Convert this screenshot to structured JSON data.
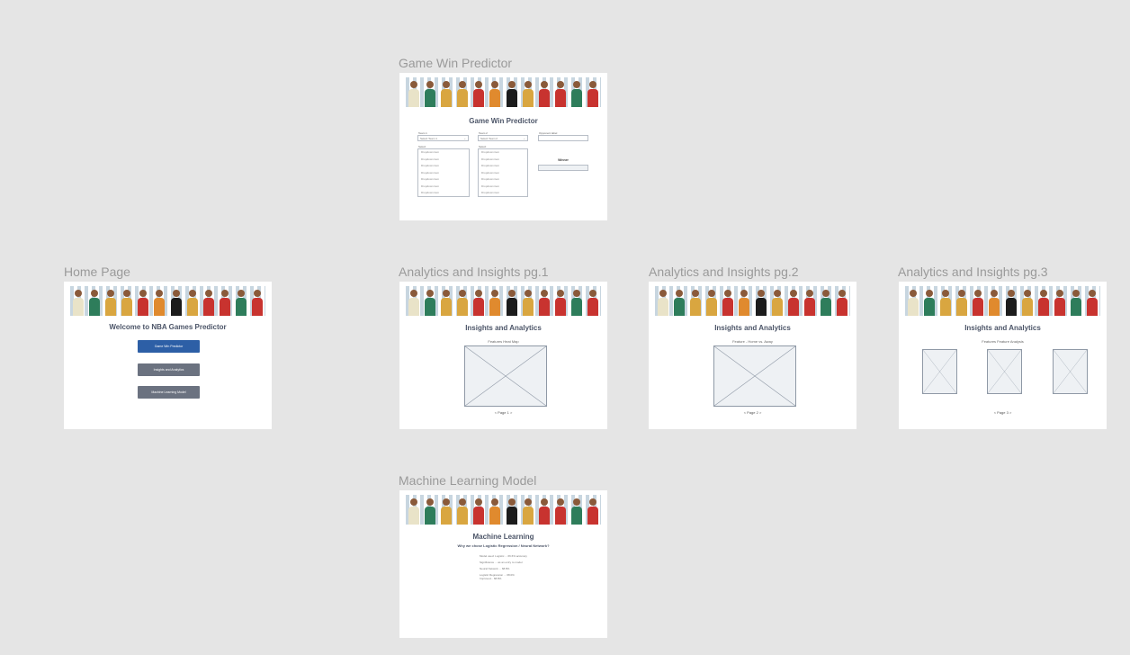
{
  "frames": {
    "gwp": {
      "label": "Game Win Predictor"
    },
    "home": {
      "label": "Home Page"
    },
    "a1": {
      "label": "Analytics and Insights pg.1"
    },
    "a2": {
      "label": "Analytics and Insights pg.2"
    },
    "a3": {
      "label": "Analytics and Insights pg.3"
    },
    "ml": {
      "label": "Machine Learning Model"
    }
  },
  "home": {
    "title": "Welcome to NBA Games Predictor",
    "buttons": [
      "Game Win Predictor",
      "Insights and Analytics",
      "Machine Learning Model"
    ]
  },
  "gwp": {
    "title": "Game Win Predictor",
    "team1_label": "Team 1",
    "team1_value": "Select Team 1",
    "team2_label": "Team 2",
    "team2_value": "Select Team 2",
    "extra_label": "Opponent label",
    "list1_label": "Select",
    "list2_label": "Select",
    "list_items": [
      "Dropdown item",
      "Dropdown item",
      "Dropdown item",
      "Dropdown item",
      "Dropdown item",
      "Dropdown item",
      "Dropdown item"
    ],
    "winner_label": "Winner"
  },
  "analytics": {
    "title": "Insights and Analytics",
    "p1_caption": "Features Heat Map",
    "p1_page": "Page 1",
    "p2_caption": "Feature - Home vs. Away",
    "p2_page": "Page 2",
    "p3_caption": "Features Feature Analysis",
    "p3_page": "Page 3",
    "prev": "<",
    "next": ">"
  },
  "ml": {
    "title": "Machine Learning",
    "subtitle": "Why we chose Logistic Regression / Neural Network?",
    "lines": [
      "Model used: Logistic ... 66.6% accuracy",
      "Significance ... as an entry to model",
      "Neural Network ... 68.8%",
      "Logistic Regression ... 68.0%",
      "Improved... 68.8%"
    ]
  },
  "colors": {
    "background": "#e5e5e5",
    "primary_button": "#2d5fa6",
    "secondary_button": "#6b7280",
    "title_text": "#4c5568"
  }
}
